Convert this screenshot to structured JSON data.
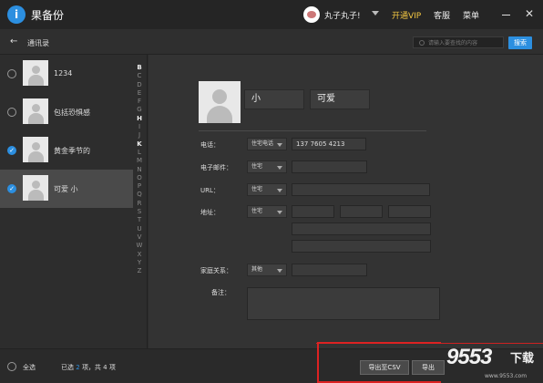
{
  "app": {
    "logo": "i",
    "title": "果备份"
  },
  "header": {
    "username": "丸子丸子!",
    "vip": "开通VIP",
    "service": "客服",
    "menu": "菜单",
    "minimize": "—",
    "close": "✕"
  },
  "toolbar": {
    "back_icon": "←",
    "breadcrumb": "通讯录",
    "search_placeholder": "请输入要查找的内容",
    "search_button": "搜索"
  },
  "contacts": [
    {
      "name": "1234",
      "checked": false,
      "selected": false
    },
    {
      "name": "包括恐惧感",
      "checked": false,
      "selected": false
    },
    {
      "name": "黄金季节的",
      "checked": true,
      "selected": false
    },
    {
      "name": "可爱 小",
      "checked": true,
      "selected": true
    }
  ],
  "alphabet": [
    "B",
    "C",
    "D",
    "E",
    "F",
    "G",
    "H",
    "I",
    "J",
    "K",
    "L",
    "M",
    "N",
    "O",
    "P",
    "Q",
    "R",
    "S",
    "T",
    "U",
    "V",
    "W",
    "X",
    "Y",
    "Z"
  ],
  "detail": {
    "first_name": "小",
    "last_name": "可爱",
    "fields": {
      "phone_label": "电话：",
      "phone_type": "住宅电话",
      "phone_value": "137 7605 4213",
      "email_label": "电子邮件：",
      "email_type": "住宅",
      "url_label": "URL：",
      "url_type": "住宅",
      "address_label": "地址：",
      "address_type": "住宅",
      "family_label": "家庭关系：",
      "family_type": "其他",
      "notes_label": "备注："
    }
  },
  "status": {
    "select_all": "全选",
    "prefix": "已选",
    "selected_count": "2",
    "middle": "项，共",
    "total": "4",
    "suffix": "项",
    "export_button": "导出至CSV",
    "other_button": "导出"
  },
  "watermark": {
    "big": "9553",
    "small": "下载",
    "url": "www.9553.com"
  },
  "colors": {
    "accent": "#2c8fe0",
    "vip": "#f5c842",
    "highlight": "#dd2222"
  }
}
